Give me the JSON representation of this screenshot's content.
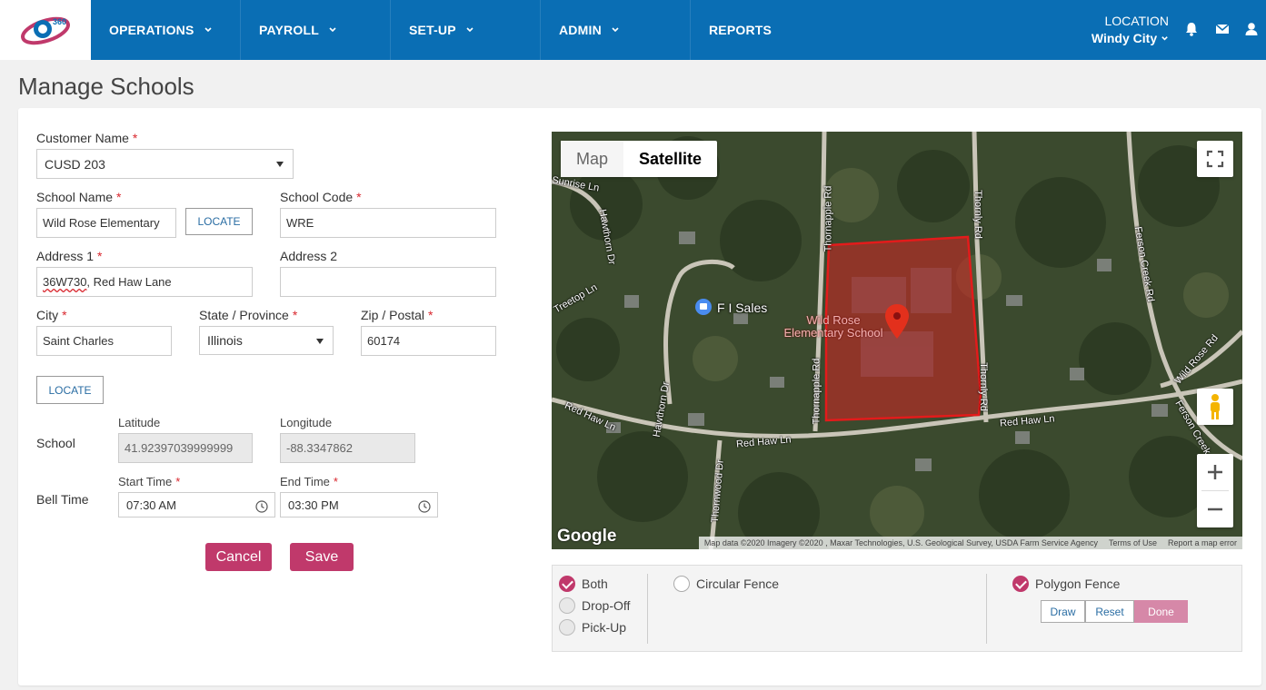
{
  "nav": {
    "items": [
      "OPERATIONS",
      "PAYROLL",
      "SET-UP",
      "ADMIN",
      "REPORTS"
    ],
    "logo_text": "360",
    "location_label": "LOCATION",
    "location_value": "Windy City"
  },
  "page": {
    "title": "Manage Schools"
  },
  "form": {
    "customer_name_label": "Customer Name",
    "customer_name_value": "CUSD 203",
    "school_name_label": "School Name",
    "school_name_value": "Wild Rose Elementary",
    "locate_label": "LOCATE",
    "school_code_label": "School Code",
    "school_code_value": "WRE",
    "address1_label": "Address 1",
    "address1_part1": "36W730",
    "address1_part2": ", Red Haw Lane",
    "address2_label": "Address 2",
    "address2_value": "",
    "city_label": "City",
    "city_value": "Saint Charles",
    "state_label": "State / Province",
    "state_value": "Illinois",
    "zip_label": "Zip / Postal",
    "zip_value": "60174",
    "locate2_label": "LOCATE",
    "school_label": "School",
    "latitude_label": "Latitude",
    "latitude_value": "41.92397039999999",
    "longitude_label": "Longitude",
    "longitude_value": "-88.3347862",
    "bell_time_label": "Bell Time",
    "start_time_label": "Start Time",
    "start_time_value": "07:30 AM",
    "end_time_label": "End Time",
    "end_time_value": "03:30 PM",
    "cancel_label": "Cancel",
    "save_label": "Save"
  },
  "map": {
    "type_map": "Map",
    "type_satellite": "Satellite",
    "roads": [
      "Sunrise Ln",
      "Hawthorn Dr",
      "Treetop Ln",
      "Thornapple Rd",
      "Thornly Rd",
      "Ferson Creek Rd",
      "Wild Rose Rd",
      "Red Haw Ln",
      "Red Haw Ln",
      "Red Haw Ln",
      "Hawthorn Dr",
      "Thornapple Rd",
      "Thornly Rd",
      "Thornwood Dr",
      "Ferson Creek"
    ],
    "poi": "F I Sales",
    "school_name_line1": "Wild Rose",
    "school_name_line2": "Elementary School",
    "google": "Google",
    "attribution": "Map data ©2020 Imagery ©2020 , Maxar Technologies, U.S. Geological Survey, USDA Farm Service Agency",
    "terms": "Terms of Use",
    "report": "Report a map error"
  },
  "fence": {
    "both": "Both",
    "dropoff": "Drop-Off",
    "pickup": "Pick-Up",
    "circular": "Circular Fence",
    "polygon": "Polygon Fence",
    "draw": "Draw",
    "reset": "Reset",
    "done": "Done"
  },
  "colors": {
    "nav": "#0a6eb4",
    "accent": "#c0396b",
    "fence_fill": "#d62424"
  }
}
